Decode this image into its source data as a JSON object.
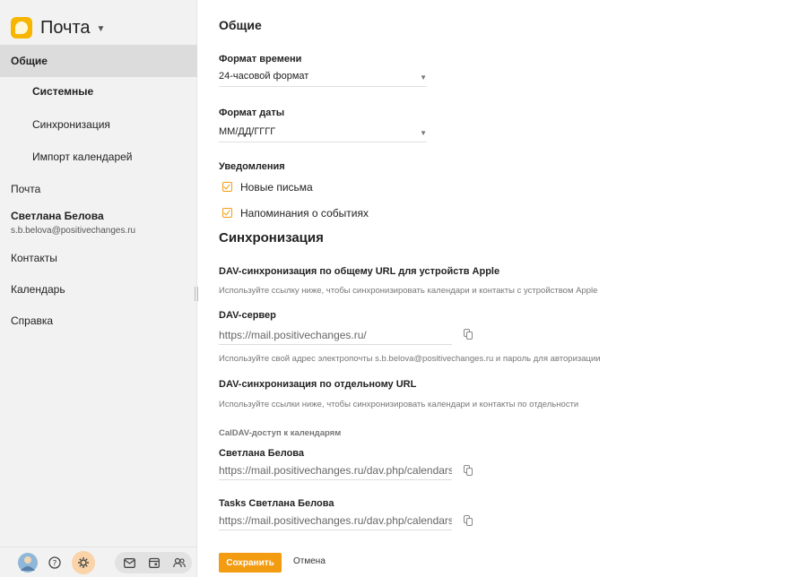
{
  "app": {
    "name": "Почта"
  },
  "sidebar": {
    "general": "Общие",
    "system": "Системные",
    "sync": "Синхронизация",
    "calendar_import": "Импорт календарей",
    "mail": "Почта",
    "account_name": "Светлана Белова",
    "account_email": "s.b.belova@positivechanges.ru",
    "contacts": "Контакты",
    "calendar": "Календарь",
    "help": "Справка"
  },
  "main": {
    "title": "Общие",
    "time_format_label": "Формат времени",
    "time_format_value": "24-часовой формат",
    "date_format_label": "Формат даты",
    "date_format_value": "ММ/ДД/ГГГГ",
    "notifications_label": "Уведомления",
    "notif_new_mail": "Новые письма",
    "notif_reminders": "Напоминания о событиях",
    "sync_title": "Синхронизация",
    "dav_apple_title": "DAV-синхронизация по общему URL для устройств Apple",
    "dav_apple_desc": "Используйте ссылку ниже, чтобы синхронизировать календари и контакты с устройством Apple",
    "dav_server_label": "DAV-сервер",
    "dav_server_value": "https://mail.positivechanges.ru/",
    "dav_auth_hint": "Используйте свой адрес электропочты s.b.belova@positivechanges.ru и пароль для авторизации",
    "dav_separate_title": "DAV-синхронизация по отдельному URL",
    "dav_separate_desc": "Используйте ссылки ниже, чтобы синхронизировать календари и контакты по отдельности",
    "caldav_label": "CalDAV-доступ к календарям",
    "cal1_name": "Светлана Белова",
    "cal1_url": "https://mail.positivechanges.ru/dav.php/calendars/s.b.belova@positivechanges.ru/personal/",
    "cal2_name": "Tasks Светлана Белова",
    "cal2_url": "https://mail.positivechanges.ru/dav.php/calendars/s.b.belova@positivechanges.ru/tasks/",
    "save": "Сохранить",
    "cancel": "Отмена"
  },
  "colors": {
    "accent": "#f39c12",
    "logo": "#f7b500",
    "sidebar_bg": "#f2f2f2",
    "active_item": "#dcdcdc"
  },
  "icons": [
    "avatar",
    "help-icon",
    "settings-icon",
    "mail-icon",
    "calendar-icon",
    "contacts-icon",
    "copy-icon"
  ]
}
